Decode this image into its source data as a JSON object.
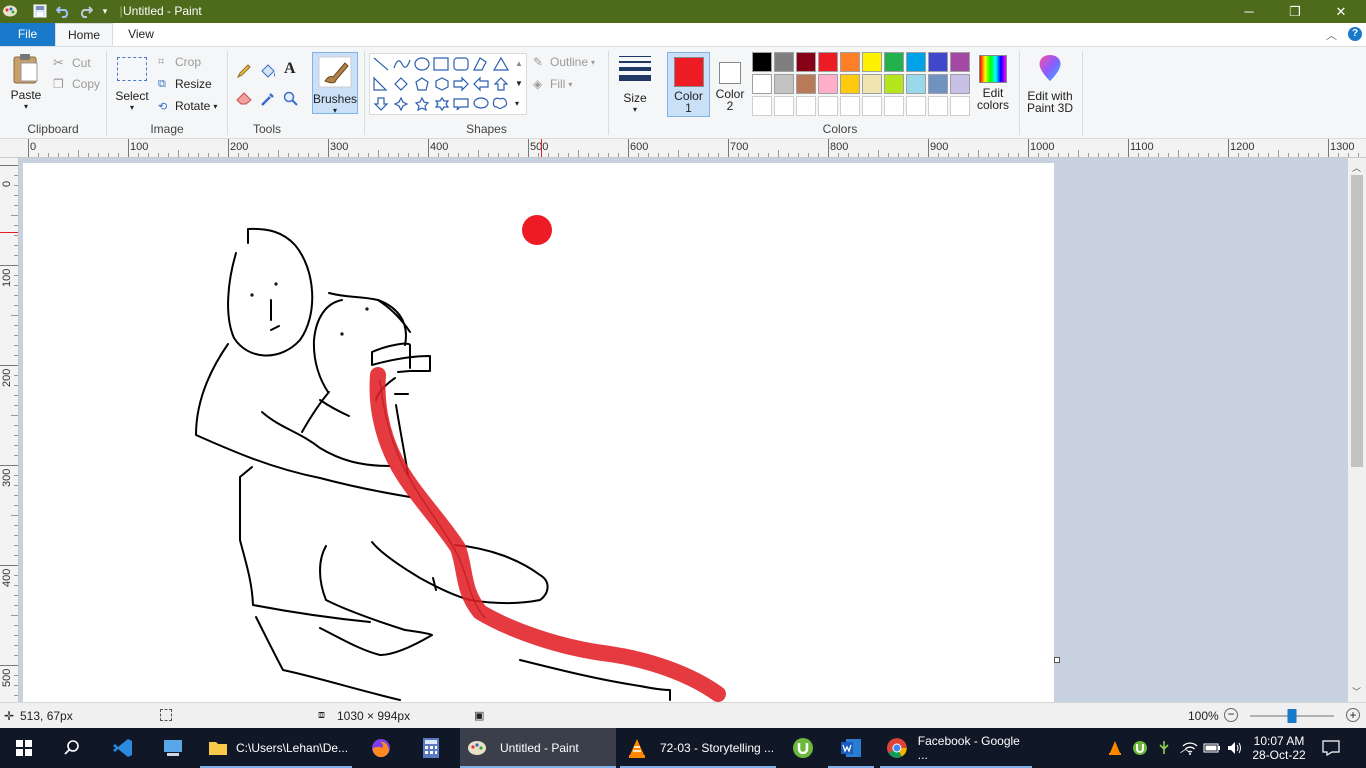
{
  "window": {
    "title": "Untitled - Paint",
    "controls": {
      "minimize": "─",
      "restore": "❐",
      "close": "✕"
    }
  },
  "quick_access": {
    "save_icon": "save-icon",
    "undo_icon": "undo-icon",
    "redo_icon": "redo-icon"
  },
  "tabs": {
    "file": "File",
    "home": "Home",
    "view": "View"
  },
  "clipboard": {
    "paste": "Paste",
    "cut": "Cut",
    "copy": "Copy",
    "label": "Clipboard"
  },
  "image": {
    "select": "Select",
    "crop": "Crop",
    "resize": "Resize",
    "rotate": "Rotate",
    "label": "Image"
  },
  "tools": {
    "label": "Tools"
  },
  "brushes": {
    "label": "Brushes"
  },
  "shapes": {
    "outline": "Outline",
    "fill": "Fill",
    "label": "Shapes"
  },
  "size": {
    "label": "Size"
  },
  "color1": {
    "line1": "Color",
    "line2": "1",
    "color": "#ed1c24"
  },
  "color2": {
    "line1": "Color",
    "line2": "2",
    "color": "#ffffff"
  },
  "colors": {
    "label": "Colors",
    "row1": [
      "#000000",
      "#7f7f7f",
      "#880015",
      "#ed1c24",
      "#ff7f27",
      "#fff200",
      "#22b14c",
      "#00a2e8",
      "#3f48cc",
      "#a349a4"
    ],
    "row2": [
      "#ffffff",
      "#c3c3c3",
      "#b97a57",
      "#ffaec9",
      "#ffc90e",
      "#efe4b0",
      "#b5e61d",
      "#99d9ea",
      "#7092be",
      "#c8bfe7"
    ],
    "row3": [
      "#ffffff",
      "#ffffff",
      "#ffffff",
      "#ffffff",
      "#ffffff",
      "#ffffff",
      "#ffffff",
      "#ffffff",
      "#ffffff",
      "#ffffff"
    ]
  },
  "edit_colors": {
    "line1": "Edit",
    "line2": "colors"
  },
  "paint3d": {
    "line1": "Edit with",
    "line2": "Paint 3D"
  },
  "ruler": {
    "top": [
      "0",
      "100",
      "200",
      "300",
      "400",
      "500",
      "600",
      "700",
      "800",
      "900",
      "1000",
      "1100",
      "1200",
      "1300"
    ],
    "left": [
      "0",
      "100",
      "200",
      "300",
      "400",
      "500"
    ]
  },
  "status": {
    "cursor": "513, 67px",
    "dimensions": "1030 × 994px",
    "zoom": "100%",
    "zoom_level": 1.0
  },
  "taskbar": {
    "explorer": "C:\\Users\\Lehan\\De...",
    "paint": "Untitled - Paint",
    "vlc": "72-03 - Storytelling ...",
    "chrome": "Facebook - Google ...",
    "time": "10:07 AM",
    "date": "28-Oct-22"
  }
}
